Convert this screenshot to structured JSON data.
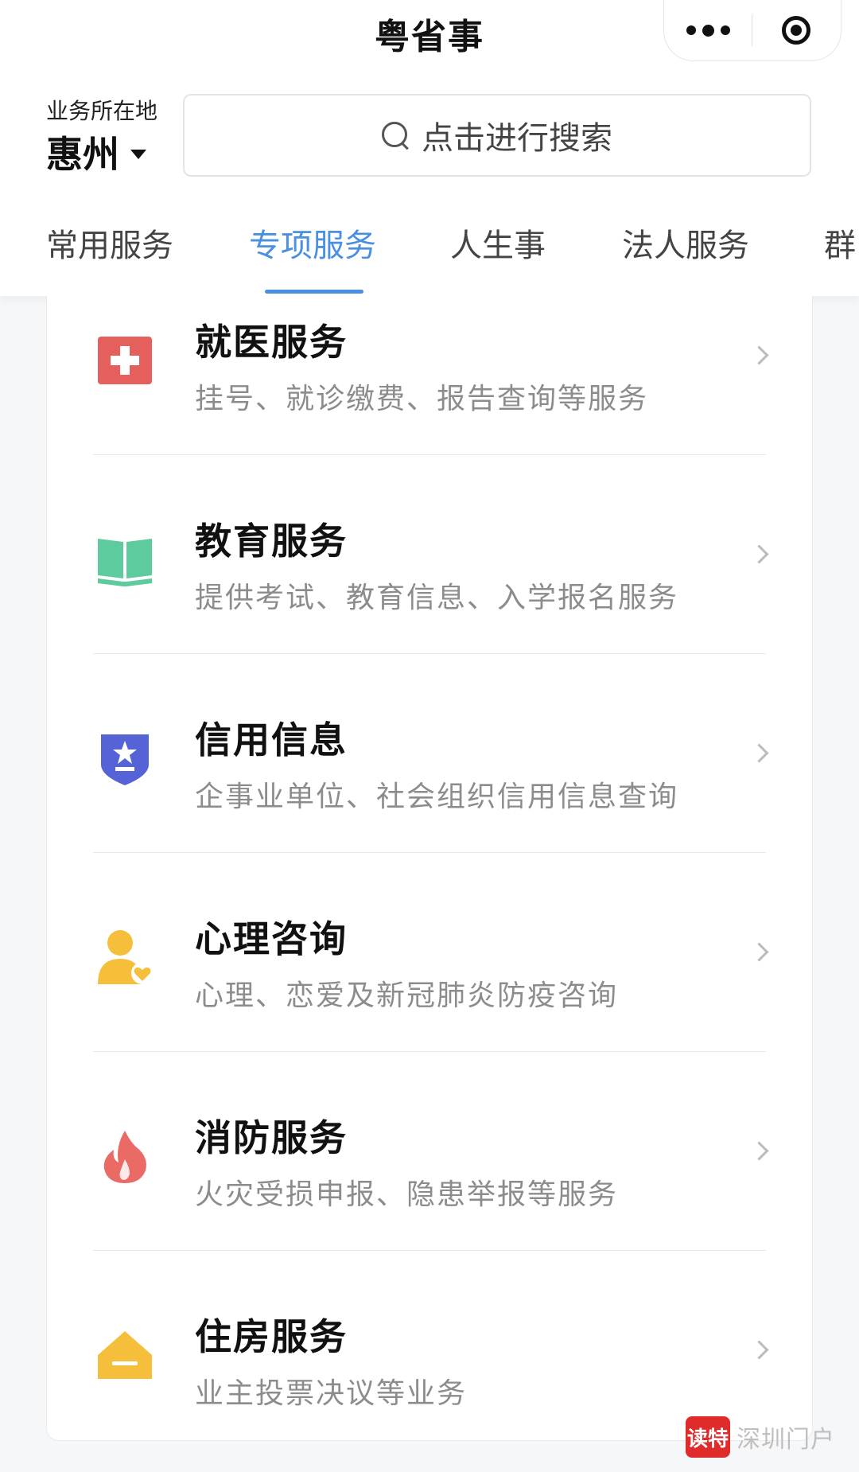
{
  "app": {
    "title": "粤省事"
  },
  "location": {
    "label": "业务所在地",
    "city": "惠州"
  },
  "search": {
    "placeholder": "点击进行搜索"
  },
  "tabs": [
    {
      "label": "常用服务",
      "active": false
    },
    {
      "label": "专项服务",
      "active": true
    },
    {
      "label": "人生事",
      "active": false
    },
    {
      "label": "法人服务",
      "active": false
    },
    {
      "label": "群",
      "active": false
    }
  ],
  "services": [
    {
      "title": "就医服务",
      "desc": "挂号、就诊缴费、报告查询等服务",
      "icon": "medical-cross-icon",
      "color": "#e5605d"
    },
    {
      "title": "教育服务",
      "desc": "提供考试、教育信息、入学报名服务",
      "icon": "open-book-icon",
      "color": "#5ecb9e"
    },
    {
      "title": "信用信息",
      "desc": "企事业单位、社会组织信用信息查询",
      "icon": "shield-star-icon",
      "color": "#5563d6"
    },
    {
      "title": "心理咨询",
      "desc": "心理、恋爱及新冠肺炎防疫咨询",
      "icon": "person-heart-icon",
      "color": "#f5bf3c"
    },
    {
      "title": "消防服务",
      "desc": "火灾受损申报、隐患举报等服务",
      "icon": "flame-icon",
      "color": "#ea6a66"
    },
    {
      "title": "住房服务",
      "desc": "业主投票决议等业务",
      "icon": "house-icon",
      "color": "#f5bf3c"
    }
  ],
  "watermark": {
    "badge": "读特",
    "text": "深圳门户"
  }
}
